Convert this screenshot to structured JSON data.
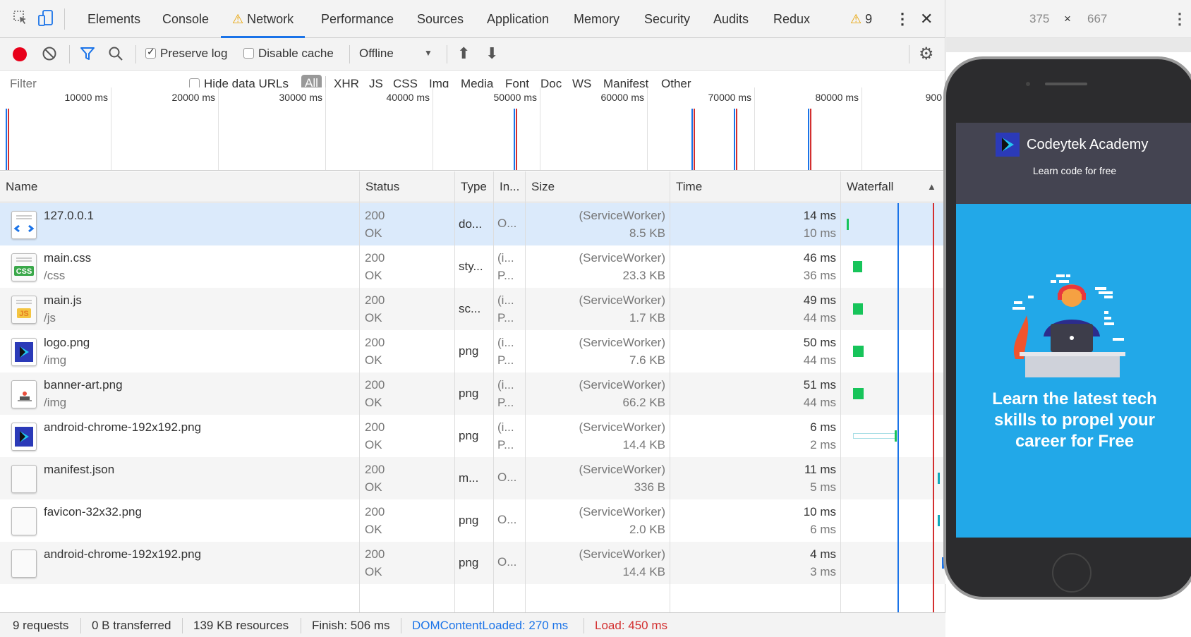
{
  "tabs": [
    {
      "label": "Elements"
    },
    {
      "label": "Console"
    },
    {
      "label": "Network"
    },
    {
      "label": "Performance"
    },
    {
      "label": "Sources"
    },
    {
      "label": "Application"
    },
    {
      "label": "Memory"
    },
    {
      "label": "Security"
    },
    {
      "label": "Audits"
    },
    {
      "label": "Redux"
    }
  ],
  "warnings_count": "9",
  "toolbar": {
    "preserve_log": "Preserve log",
    "disable_cache": "Disable cache",
    "throttle": "Offline"
  },
  "filter": {
    "placeholder": "Filter",
    "hide_data_urls": "Hide data URLs",
    "types": [
      "All",
      "XHR",
      "JS",
      "CSS",
      "Img",
      "Media",
      "Font",
      "Doc",
      "WS",
      "Manifest",
      "Other"
    ]
  },
  "overview": {
    "labels": [
      "10000 ms",
      "20000 ms",
      "30000 ms",
      "40000 ms",
      "50000 ms",
      "60000 ms",
      "70000 ms",
      "80000 ms",
      "900"
    ]
  },
  "columns": {
    "name": "Name",
    "status": "Status",
    "type": "Type",
    "initiator": "In...",
    "size": "Size",
    "time": "Time",
    "waterfall": "Waterfall"
  },
  "requests": [
    {
      "name": "127.0.0.1",
      "path": "",
      "status": "200",
      "status_text": "OK",
      "type": "do...",
      "initiator": "O...",
      "initiator2": "",
      "size": "(ServiceWorker)",
      "size2": "8.5 KB",
      "time": "14 ms",
      "latency": "10 ms",
      "icon": "html-icon"
    },
    {
      "name": "main.css",
      "path": "/css",
      "status": "200",
      "status_text": "OK",
      "type": "sty...",
      "initiator": "(i...",
      "initiator2": "P...",
      "size": "(ServiceWorker)",
      "size2": "23.3 KB",
      "time": "46 ms",
      "latency": "36 ms",
      "icon": "css-icon"
    },
    {
      "name": "main.js",
      "path": "/js",
      "status": "200",
      "status_text": "OK",
      "type": "sc...",
      "initiator": "(i...",
      "initiator2": "P...",
      "size": "(ServiceWorker)",
      "size2": "1.7 KB",
      "time": "49 ms",
      "latency": "44 ms",
      "icon": "js-icon"
    },
    {
      "name": "logo.png",
      "path": "/img",
      "status": "200",
      "status_text": "OK",
      "type": "png",
      "initiator": "(i...",
      "initiator2": "P...",
      "size": "(ServiceWorker)",
      "size2": "7.6 KB",
      "time": "50 ms",
      "latency": "44 ms",
      "icon": "logo-icon"
    },
    {
      "name": "banner-art.png",
      "path": "/img",
      "status": "200",
      "status_text": "OK",
      "type": "png",
      "initiator": "(i...",
      "initiator2": "P...",
      "size": "(ServiceWorker)",
      "size2": "66.2 KB",
      "time": "51 ms",
      "latency": "44 ms",
      "icon": "image-icon"
    },
    {
      "name": "android-chrome-192x192.png",
      "path": "",
      "status": "200",
      "status_text": "OK",
      "type": "png",
      "initiator": "(i...",
      "initiator2": "P...",
      "size": "(ServiceWorker)",
      "size2": "14.4 KB",
      "time": "6 ms",
      "latency": "2 ms",
      "icon": "logo-icon"
    },
    {
      "name": "manifest.json",
      "path": "",
      "status": "200",
      "status_text": "OK",
      "type": "m...",
      "initiator": "O...",
      "initiator2": "",
      "size": "(ServiceWorker)",
      "size2": "336 B",
      "time": "11 ms",
      "latency": "5 ms",
      "icon": "blank-icon"
    },
    {
      "name": "favicon-32x32.png",
      "path": "",
      "status": "200",
      "status_text": "OK",
      "type": "png",
      "initiator": "O...",
      "initiator2": "",
      "size": "(ServiceWorker)",
      "size2": "2.0 KB",
      "time": "10 ms",
      "latency": "6 ms",
      "icon": "blank-icon"
    },
    {
      "name": "android-chrome-192x192.png",
      "path": "",
      "status": "200",
      "status_text": "OK",
      "type": "png",
      "initiator": "O...",
      "initiator2": "",
      "size": "(ServiceWorker)",
      "size2": "14.4 KB",
      "time": "4 ms",
      "latency": "3 ms",
      "icon": "blank-icon"
    }
  ],
  "status_bar": {
    "requests": "9 requests",
    "transferred": "0 B transferred",
    "resources": "139 KB resources",
    "finish": "Finish: 506 ms",
    "dcl": "DOMContentLoaded: 270 ms",
    "load": "Load: 450 ms"
  },
  "device": {
    "width": "375",
    "times": "×",
    "height": "667"
  },
  "app": {
    "title": "Codeytek Academy",
    "tagline": "Learn code for free",
    "hero_text": "Learn the latest tech skills to propel your career for Free"
  },
  "colors": {
    "accent": "#1a73e8",
    "record": "#e8001a",
    "dcl": "#1a73e8",
    "load": "#d32f2f",
    "app_bar": "#444451",
    "hero": "#22a8e8",
    "waterfall_green": "#17c45a"
  }
}
